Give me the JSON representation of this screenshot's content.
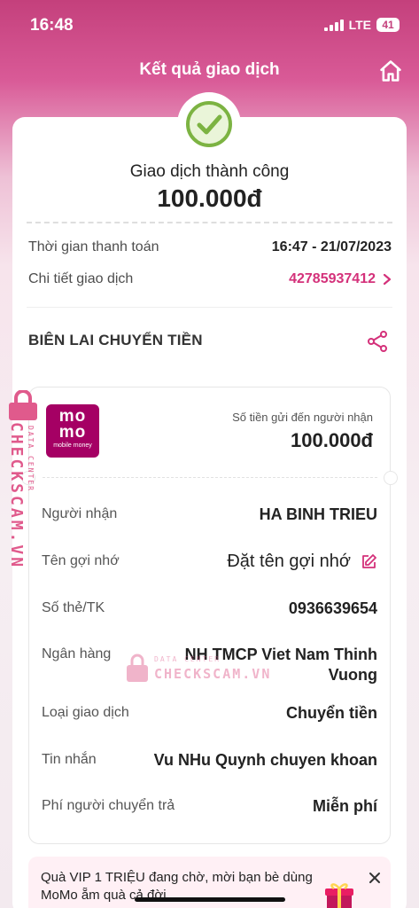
{
  "status_bar": {
    "time": "16:48",
    "network": "LTE",
    "battery": "41"
  },
  "header": {
    "title": "Kết quả giao dịch",
    "home_icon": "home-icon"
  },
  "result": {
    "status_text": "Giao dịch thành công",
    "amount": "100.000đ",
    "status_icon": "check-circle-icon",
    "accent_color": "#8bc34a"
  },
  "details": {
    "time_label": "Thời gian thanh toán",
    "time_value": "16:47 - 21/07/2023",
    "detail_label": "Chi tiết giao dịch",
    "detail_value": "42785937412"
  },
  "receipt": {
    "section_title": "BIÊN LAI CHUYỂN TIỀN",
    "share_icon": "share-icon",
    "logo": {
      "line1": "mo",
      "line2": "mo",
      "tagline": "mobile money"
    },
    "sent_label": "Số tiền gửi đến người nhận",
    "sent_amount": "100.000đ",
    "rows": [
      {
        "label": "Người nhận",
        "value": "HA BINH TRIEU"
      },
      {
        "label": "Tên gợi nhớ",
        "value": "Đặt tên gợi nhớ"
      },
      {
        "label": "Số thẻ/TK",
        "value": "0936639654"
      },
      {
        "label": "Ngân hàng",
        "value": "NH TMCP Viet Nam Thinh Vuong"
      },
      {
        "label": "Loại giao dịch",
        "value": "Chuyển tiền"
      },
      {
        "label": "Tin nhắn",
        "value": "Vu NHu Quynh chuyen khoan"
      },
      {
        "label": "Phí người chuyển trả",
        "value": "Miễn phí"
      }
    ]
  },
  "watermark": {
    "line1": "DATA CENTER",
    "line2": "CHECKSCAM.VN"
  },
  "promo": {
    "text": "Quà VIP 1 TRIỆU đang chờ, mời bạn bè dùng MoMo ẵm quà cả đời"
  },
  "colors": {
    "brand": "#a50064",
    "accent_pink": "#d4317a"
  }
}
